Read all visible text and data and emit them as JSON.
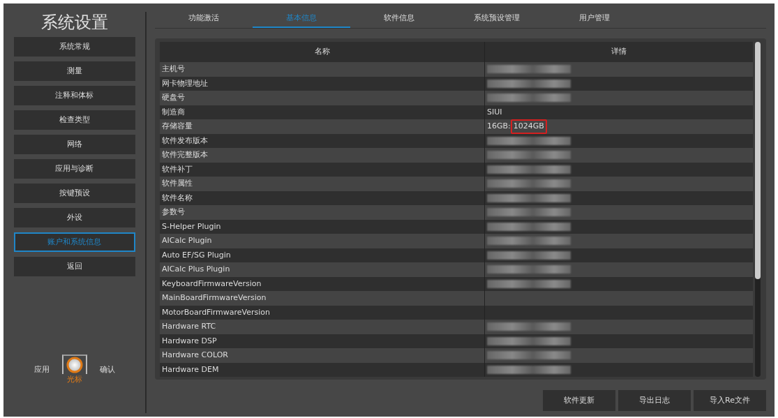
{
  "sidebar": {
    "title": "系统设置",
    "items": [
      {
        "label": "系统常规",
        "selected": false
      },
      {
        "label": "测量",
        "selected": false
      },
      {
        "label": "注释和体标",
        "selected": false
      },
      {
        "label": "检查类型",
        "selected": false
      },
      {
        "label": "网络",
        "selected": false
      },
      {
        "label": "应用与诊断",
        "selected": false
      },
      {
        "label": "按键预设",
        "selected": false
      },
      {
        "label": "外设",
        "selected": false
      },
      {
        "label": "账户和系统信息",
        "selected": true
      },
      {
        "label": "返回",
        "selected": false
      }
    ],
    "cursor_control": {
      "left": "应用",
      "right": "确认",
      "caption": "光标"
    }
  },
  "tabs": [
    {
      "label": "功能激活",
      "selected": false
    },
    {
      "label": "基本信息",
      "selected": true
    },
    {
      "label": "软件信息",
      "selected": false
    },
    {
      "label": "系统预设管理",
      "selected": false
    },
    {
      "label": "用户管理",
      "selected": false
    }
  ],
  "table": {
    "columns": [
      "名称",
      "详情"
    ],
    "rows": [
      {
        "name": "主机号",
        "redacted": true
      },
      {
        "name": "网卡物理地址",
        "redacted": true
      },
      {
        "name": "硬盘号",
        "redacted": true
      },
      {
        "name": "制造商",
        "detail": "SIUI",
        "redacted": false
      },
      {
        "name": "存储容量",
        "detail": "16GB:",
        "marked": "1024GB",
        "redacted": false
      },
      {
        "name": "软件发布版本",
        "redacted": true
      },
      {
        "name": "软件完整版本",
        "redacted": true
      },
      {
        "name": "软件补丁",
        "redacted": true
      },
      {
        "name": "软件属性",
        "redacted": true
      },
      {
        "name": "软件名称",
        "redacted": true
      },
      {
        "name": "参数号",
        "redacted": true
      },
      {
        "name": "S-Helper Plugin",
        "redacted": true
      },
      {
        "name": "AICalc Plugin",
        "redacted": true
      },
      {
        "name": "Auto EF/SG Plugin",
        "redacted": true
      },
      {
        "name": "AICalc Plus Plugin",
        "redacted": true
      },
      {
        "name": "KeyboardFirmwareVersion",
        "redacted": true
      },
      {
        "name": "MainBoardFirmwareVersion",
        "redacted": false
      },
      {
        "name": "MotorBoardFirmwareVersion",
        "redacted": false
      },
      {
        "name": "Hardware RTC",
        "redacted": true
      },
      {
        "name": "Hardware DSP",
        "redacted": true
      },
      {
        "name": "Hardware COLOR",
        "redacted": true
      },
      {
        "name": "Hardware DEM",
        "redacted": true
      }
    ]
  },
  "buttons": [
    "软件更新",
    "导出日志",
    "导入Re文件"
  ]
}
